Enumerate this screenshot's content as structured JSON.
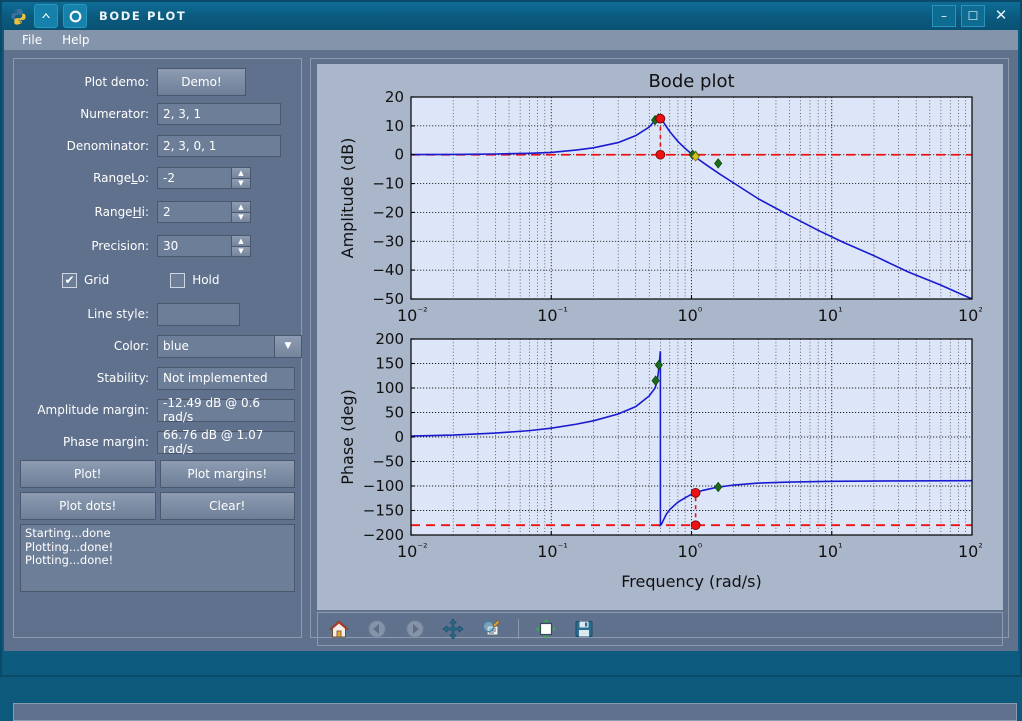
{
  "window": {
    "title": "Bode plot",
    "icons": [
      "python-logo-icon",
      "chevron-up-icon",
      "circle-dot-icon"
    ],
    "minimize": "–",
    "maximize": "☐",
    "close": "✕"
  },
  "menubar": {
    "items": [
      "File",
      "Help"
    ]
  },
  "controls": {
    "plot_demo_label": "Plot demo:",
    "demo_button": "Demo!",
    "numerator_label": "Numerator:",
    "numerator_value": "2, 3, 1",
    "denominator_label": "Denominator:",
    "denominator_value": "2, 3, 0, 1",
    "rangelo_label_a": "Range",
    "rangelo_label_u": "L",
    "rangelo_label_b": "o:",
    "rangelo_value": "-2",
    "rangehi_label_a": "Range",
    "rangehi_label_u": "H",
    "rangehi_label_b": "i:",
    "rangehi_value": "2",
    "precision_label": "Precision:",
    "precision_value": "30",
    "grid_label": "Grid",
    "grid_checked": "✔",
    "hold_label": "Hold",
    "linestyle_label": "Line style:",
    "linestyle_value": "",
    "color_label": "Color:",
    "color_value": "blue",
    "color_arrow": "▼",
    "stability_label": "Stability:",
    "stability_value": "Not implemented",
    "amp_margin_label": "Amplitude margin:",
    "amp_margin_value": "-12.49 dB @ 0.6 rad/s",
    "phase_margin_label": "Phase margin:",
    "phase_margin_value": "66.76 dB @ 1.07 rad/s",
    "plot_button": "Plot!",
    "plot_margins_button": "Plot margins!",
    "plot_dots_button": "Plot dots!",
    "clear_button": "Clear!",
    "log_text": "Starting...done\nPlotting...done!\nPlotting...done!"
  },
  "toolbar": {
    "buttons": [
      "home-icon",
      "back-arrow-icon",
      "forward-arrow-icon",
      "pan-move-icon",
      "zoom-rect-icon",
      "subplot-config-icon",
      "save-floppy-icon"
    ]
  },
  "chart_data": [
    {
      "type": "line",
      "title": "Bode plot",
      "xlabel": "",
      "ylabel": "Amplitude (dB)",
      "xscale": "log",
      "xlim": [
        0.01,
        100
      ],
      "ylim": [
        -50,
        20
      ],
      "xticks": [
        "10⁻²",
        "10⁻¹",
        "10⁰",
        "10¹",
        "10²"
      ],
      "xtick_values": [
        0.01,
        0.1,
        1,
        10,
        100
      ],
      "yticks": [
        "20",
        "10",
        "0",
        "−10",
        "−20",
        "−30",
        "−40",
        "−50"
      ],
      "ytick_values": [
        20,
        10,
        0,
        -10,
        -20,
        -30,
        -40,
        -50
      ],
      "grid": true,
      "series": [
        {
          "name": "magnitude",
          "color": "#1a1ad0",
          "x": [
            0.01,
            0.02,
            0.04,
            0.07,
            0.1,
            0.15,
            0.2,
            0.3,
            0.4,
            0.5,
            0.55,
            0.575,
            0.59,
            0.6,
            0.62,
            0.65,
            0.7,
            0.8,
            0.9,
            1.0,
            1.1,
            1.3,
            1.6,
            2.0,
            3.0,
            5.0,
            8.0,
            12.0,
            20.0,
            35.0,
            60.0,
            100.0
          ],
          "y": [
            0.05,
            0.1,
            0.25,
            0.5,
            0.8,
            1.6,
            2.4,
            4.2,
            6.6,
            9.6,
            11.9,
            12.6,
            12.9,
            12.7,
            11.9,
            10.3,
            8.0,
            4.6,
            2.2,
            0.3,
            -1.3,
            -3.8,
            -6.8,
            -9.8,
            -15.3,
            -21.1,
            -26.2,
            -30.3,
            -35.0,
            -40.6,
            -45.2,
            -50.0
          ]
        }
      ],
      "hlines": [
        {
          "y": 0,
          "color": "#ee1111",
          "style": "dashed"
        }
      ],
      "vlines": [
        {
          "x": 0.6,
          "color": "#ee1111",
          "style": "dashed",
          "y0": 0,
          "y1": 12.7
        }
      ],
      "markers_green": [
        {
          "x": 0.55,
          "y": 12.0
        },
        {
          "x": 0.58,
          "y": 12.6
        },
        {
          "x": 1.02,
          "y": 0.0
        },
        {
          "x": 1.07,
          "y": -0.4
        },
        {
          "x": 1.55,
          "y": -3.0
        }
      ],
      "markers_yellow": [
        {
          "x": 1.07,
          "y": -0.6
        }
      ],
      "markers_red": [
        {
          "x": 0.6,
          "y": 12.5
        },
        {
          "x": 0.6,
          "y": 0.0
        }
      ]
    },
    {
      "type": "line",
      "title": "",
      "xlabel": "Frequency (rad/s)",
      "ylabel": "Phase (deg)",
      "xscale": "log",
      "xlim": [
        0.01,
        100
      ],
      "ylim": [
        -200,
        200
      ],
      "xticks": [
        "10⁻²",
        "10⁻¹",
        "10⁰",
        "10¹",
        "10²"
      ],
      "xtick_values": [
        0.01,
        0.1,
        1,
        10,
        100
      ],
      "yticks": [
        "200",
        "150",
        "100",
        "50",
        "0",
        "−50",
        "−100",
        "−150",
        "−200"
      ],
      "ytick_values": [
        200,
        150,
        100,
        50,
        0,
        -50,
        -100,
        -150,
        -200
      ],
      "grid": true,
      "series": [
        {
          "name": "phase",
          "color": "#1a1ad0",
          "x": [
            0.01,
            0.02,
            0.04,
            0.07,
            0.1,
            0.15,
            0.2,
            0.3,
            0.4,
            0.5,
            0.55,
            0.57,
            0.585,
            0.5999,
            0.6001,
            0.61,
            0.63,
            0.66,
            0.7,
            0.8,
            0.9,
            1.0,
            1.07,
            1.2,
            1.5,
            2.0,
            3.0,
            5.0,
            10.0,
            30.0,
            100.0
          ],
          "y": [
            2,
            4,
            8,
            13,
            18,
            26,
            33,
            47,
            62,
            84,
            100,
            114,
            140,
            175,
            -180,
            -178,
            -170,
            -158,
            -148,
            -133,
            -124,
            -117,
            -114,
            -109,
            -103,
            -98,
            -94,
            -92,
            -90.5,
            -89.6,
            -89.2
          ]
        }
      ],
      "hlines": [
        {
          "y": -180,
          "color": "#ee1111",
          "style": "dashed"
        }
      ],
      "vlines": [
        {
          "x": 1.07,
          "color": "#ee1111",
          "style": "dashed",
          "y0": -180,
          "y1": -114
        }
      ],
      "markers_green": [
        {
          "x": 0.555,
          "y": 115
        },
        {
          "x": 0.585,
          "y": 147
        },
        {
          "x": 1.55,
          "y": -102
        }
      ],
      "markers_red": [
        {
          "x": 1.07,
          "y": -114
        },
        {
          "x": 1.07,
          "y": -180
        }
      ]
    }
  ],
  "colors": {
    "window_frame": "#0d5c80",
    "panel_bg": "#5f718c",
    "field_bg": "#6d7e98",
    "plot_bg": "#dde6f8",
    "figure_bg": "#aab6ca",
    "line_blue": "#1a1ad0",
    "marker_red": "#ee1111",
    "marker_green": "#1b6b1b",
    "marker_yellow": "#d4c020"
  }
}
